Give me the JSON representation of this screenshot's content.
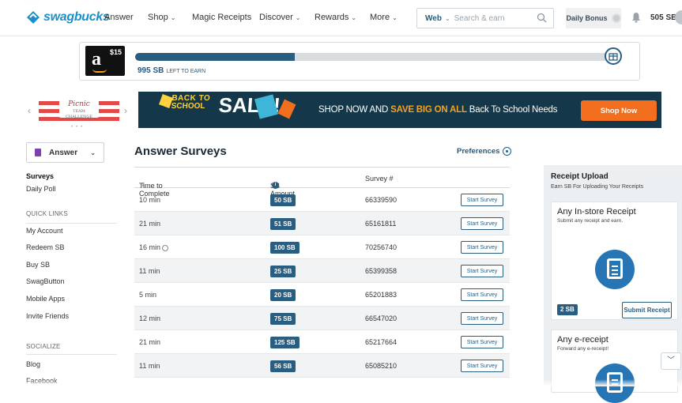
{
  "brand": {
    "name": "swagbucks"
  },
  "nav": {
    "answer": "Answer",
    "shop": "Shop",
    "magic_receipts": "Magic Receipts",
    "discover": "Discover",
    "rewards": "Rewards",
    "more": "More"
  },
  "search": {
    "scope": "Web",
    "placeholder": "Search & earn"
  },
  "daily_bonus": "Daily Bonus",
  "sb_balance": "505 SB",
  "goal": {
    "card_value": "$15",
    "progress_fraction": 0.33,
    "amount": "995 SB",
    "note": "LEFT TO EARN"
  },
  "promo_small": {
    "title": "Picnic",
    "subtitle": "TEAM CHALLENGE"
  },
  "banner": {
    "line1": "BACK TO",
    "line2": "SCHOOL",
    "sale": "SALE!",
    "msg_pre": "SHOP NOW AND ",
    "msg_strong": "SAVE BIG ON ALL",
    "msg_post": " Back To School Needs",
    "cta": "Shop Now"
  },
  "sidebar": {
    "selector": "Answer",
    "surveys": "Surveys",
    "daily_poll": "Daily Poll",
    "quick_links_header": "QUICK LINKS",
    "links": [
      "My Account",
      "Redeem SB",
      "Buy SB",
      "SwagButton",
      "Mobile Apps",
      "Invite Friends"
    ],
    "socialize_header": "SOCIALIZE",
    "social": [
      "Blog",
      "Facebook"
    ]
  },
  "main": {
    "title": "Answer Surveys",
    "preferences": "Preferences"
  },
  "table": {
    "headers": {
      "time": "Time to Complete",
      "amount": "SB Amount",
      "survey": "Survey #"
    },
    "start_label": "Start Survey",
    "rows": [
      {
        "time": "10 min",
        "sb": "50 SB",
        "id": "66339590"
      },
      {
        "time": "21 min",
        "sb": "51 SB",
        "id": "65161811"
      },
      {
        "time": "16 min",
        "sb": "100 SB",
        "id": "70256740"
      },
      {
        "time": "11 min",
        "sb": "25 SB",
        "id": "65399358"
      },
      {
        "time": "5 min",
        "sb": "20 SB",
        "id": "65201883"
      },
      {
        "time": "12 min",
        "sb": "75 SB",
        "id": "66547020"
      },
      {
        "time": "21 min",
        "sb": "125 SB",
        "id": "65217664"
      },
      {
        "time": "11 min",
        "sb": "56 SB",
        "id": "65085210"
      }
    ]
  },
  "receipts": {
    "title": "Receipt Upload",
    "subtitle": "Earn SB For Uploading Your Receipts",
    "card1": {
      "title": "Any In-store Receipt",
      "sub": "Submit any receipt and earn.",
      "sb": "2 SB",
      "cta": "Submit Receipt"
    },
    "card2": {
      "title": "Any e-receipt",
      "sub": "Forward any e-receipt!"
    }
  },
  "colors": {
    "brand": "#1a8fc9",
    "primary": "#2a5e80",
    "banner_bg": "#14384a",
    "cta_orange": "#f06e1d"
  }
}
